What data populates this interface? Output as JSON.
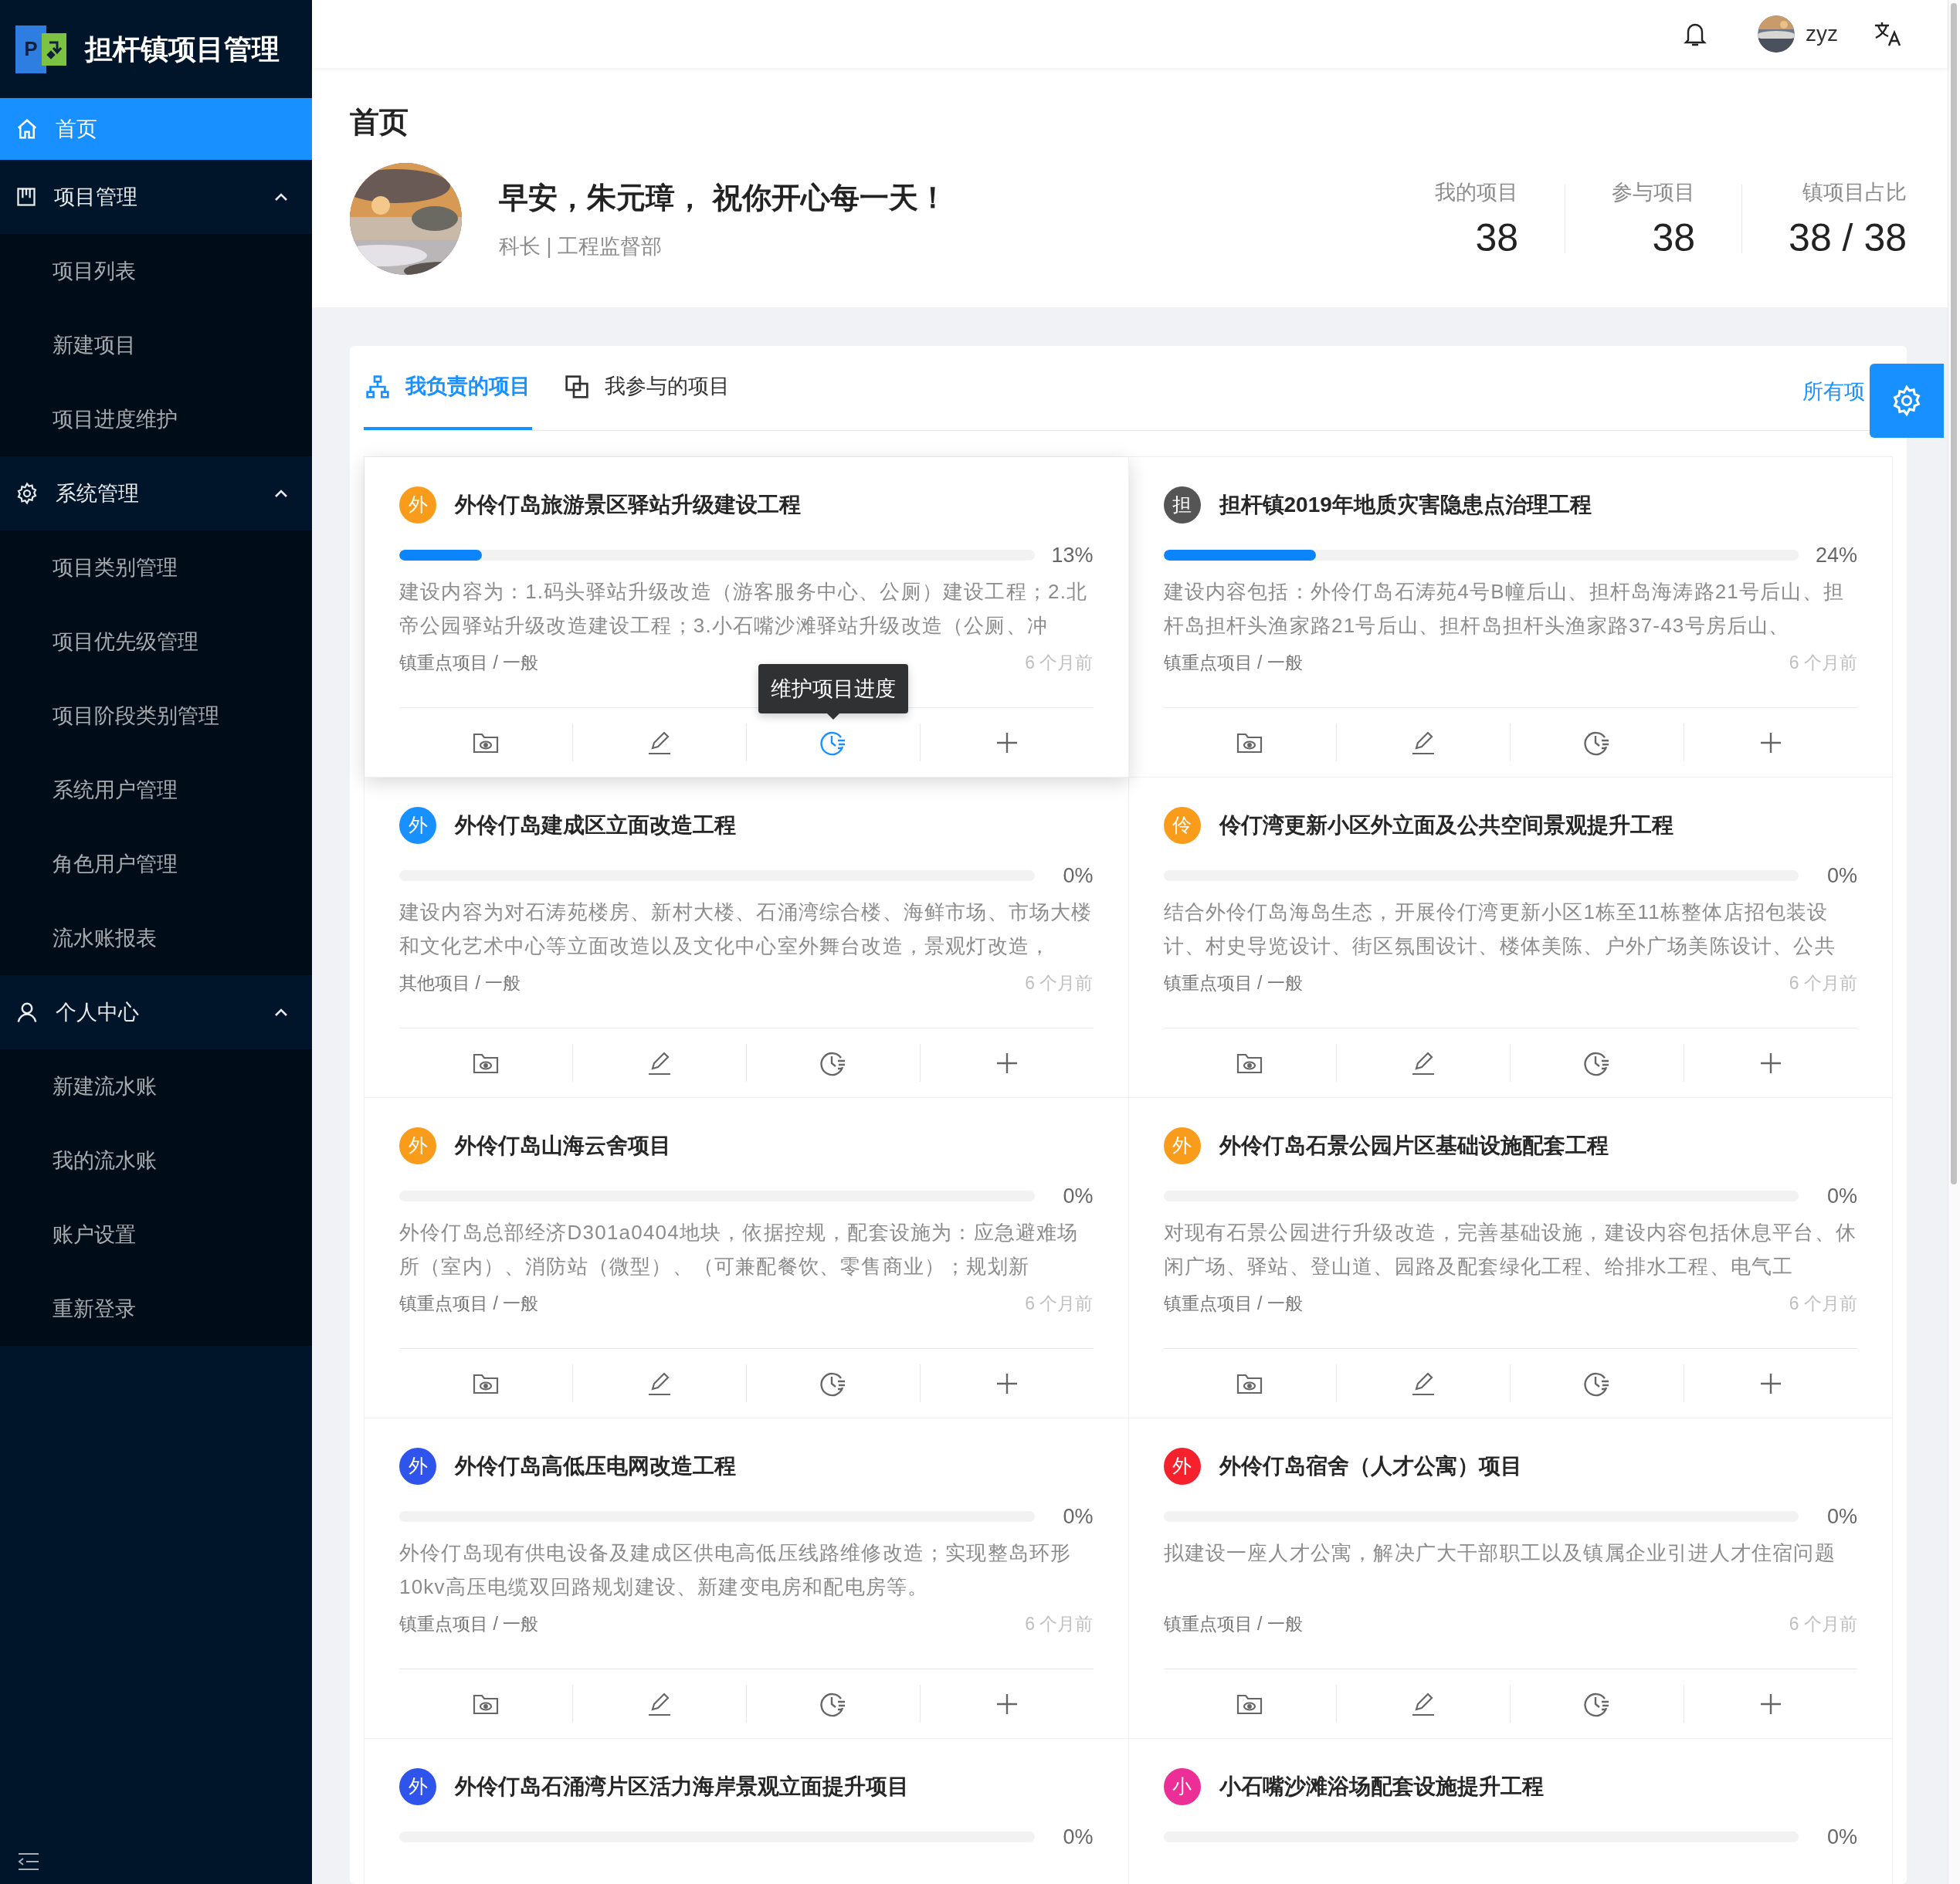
{
  "app": {
    "logo_letter": "P",
    "title": "担杆镇项目管理"
  },
  "menu": [
    {
      "label": "首页",
      "selected": true
    },
    {
      "label": "项目管理",
      "selected": false,
      "expanded": true,
      "children": [
        {
          "label": "项目列表",
          "selected": false
        },
        {
          "label": "新建项目",
          "selected": false
        },
        {
          "label": "项目进度维护",
          "selected": false
        }
      ]
    },
    {
      "label": "系统管理",
      "selected": false,
      "expanded": true,
      "children": [
        {
          "label": "项目类别管理",
          "selected": false
        },
        {
          "label": "项目优先级管理",
          "selected": false
        },
        {
          "label": "项目阶段类别管理",
          "selected": false
        },
        {
          "label": "系统用户管理",
          "selected": false
        },
        {
          "label": "角色用户管理",
          "selected": false
        },
        {
          "label": "流水账报表",
          "selected": false
        }
      ]
    },
    {
      "label": "个人中心",
      "selected": false,
      "expanded": true,
      "children": [
        {
          "label": "新建流水账",
          "selected": false
        },
        {
          "label": "我的流水账",
          "selected": false
        },
        {
          "label": "账户设置",
          "selected": false
        },
        {
          "label": "重新登录",
          "selected": false
        }
      ]
    }
  ],
  "header": {
    "username": "zyz"
  },
  "page": {
    "title": "首页",
    "greeting": "早安，朱元璋， 祝你开心每一天！",
    "subtitle": "科长 | 工程监督部",
    "stats": [
      {
        "label": "我的项目",
        "value": "38"
      },
      {
        "label": "参与项目",
        "value": "38"
      },
      {
        "label": "镇项目占比",
        "value": "38 / 38"
      }
    ]
  },
  "tabs": [
    {
      "label": "我负责的项目",
      "selected": true
    },
    {
      "label": "我参与的项目",
      "selected": false
    }
  ],
  "all_link": "所有项",
  "cards": [
    {
      "badge": "外",
      "color": "#fa9c1b",
      "title": "外伶仃岛旅游景区驿站升级建设工程",
      "level": 0.13,
      "percent": "13%",
      "description": "建设内容为：1.码头驿站升级改造（游客服务中心、公厕）建设工程；2.北帝公园驿站升级改造建设工程；3.小石嘴沙滩驿站升级改造（公厕、冲",
      "category": "镇重点项目 / 一般",
      "time": "6 个月前",
      "raised": true,
      "tooltip": "维护项目进度",
      "actions": [
        {
          "kind": "view",
          "selected": false
        },
        {
          "kind": "edit",
          "selected": false
        },
        {
          "kind": "progress",
          "selected": true
        },
        {
          "kind": "add",
          "selected": false
        }
      ]
    },
    {
      "badge": "担",
      "color": "#555555",
      "title": "担杆镇2019年地质灾害隐患点治理工程",
      "level": 0.24,
      "percent": "24%",
      "description": "建设内容包括：外伶仃岛石涛苑4号B幢后山、担杆岛海涛路21号后山、担杆岛担杆头渔家路21号后山、担杆岛担杆头渔家路37-43号房后山、",
      "category": "镇重点项目 / 一般",
      "time": "6 个月前",
      "raised": false
    },
    {
      "badge": "外",
      "color": "#1890ff",
      "title": "外伶仃岛建成区立面改造工程",
      "level": 0,
      "percent": "0%",
      "description": "建设内容为对石涛苑楼房、新村大楼、石涌湾综合楼、海鲜市场、市场大楼和文化艺术中心等立面改造以及文化中心室外舞台改造，景观灯改造，",
      "category": "其他项目 / 一般",
      "time": "6 个月前",
      "raised": false
    },
    {
      "badge": "伶",
      "color": "#fa9c1b",
      "title": "伶仃湾更新小区外立面及公共空间景观提升工程",
      "level": 0,
      "percent": "0%",
      "description": "结合外伶仃岛海岛生态，开展伶仃湾更新小区1栋至11栋整体店招包装设计、村史导览设计、街区氛围设计、楼体美陈、户外广场美陈设计、公共",
      "category": "镇重点项目 / 一般",
      "time": "6 个月前",
      "raised": false
    },
    {
      "badge": "外",
      "color": "#fa9c1b",
      "title": "外伶仃岛山海云舍项目",
      "level": 0,
      "percent": "0%",
      "description": "外伶仃岛总部经济D301a0404地块，依据控规，配套设施为：应急避难场所（室内）、消防站（微型）、（可兼配餐饮、零售商业）；规划新",
      "category": "镇重点项目 / 一般",
      "time": "6 个月前",
      "raised": false
    },
    {
      "badge": "外",
      "color": "#fa9c1b",
      "title": "外伶仃岛石景公园片区基础设施配套工程",
      "level": 0,
      "percent": "0%",
      "description": "对现有石景公园进行升级改造，完善基础设施，建设内容包括休息平台、休闲广场、驿站、登山道、园路及配套绿化工程、给排水工程、电气工",
      "category": "镇重点项目 / 一般",
      "time": "6 个月前",
      "raised": false
    },
    {
      "badge": "外",
      "color": "#2f54eb",
      "title": "外伶仃岛高低压电网改造工程",
      "level": 0,
      "percent": "0%",
      "description": "外伶仃岛现有供电设备及建成区供电高低压线路维修改造；实现整岛环形10kv高压电缆双回路规划建设、新建变电房和配电房等。",
      "category": "镇重点项目 / 一般",
      "time": "6 个月前",
      "raised": false
    },
    {
      "badge": "外",
      "color": "#f5222d",
      "title": "外伶仃岛宿舍（人才公寓）项目",
      "level": 0,
      "percent": "0%",
      "description": "拟建设一座人才公寓，解决广大干部职工以及镇属企业引进人才住宿问题",
      "category": "镇重点项目 / 一般",
      "time": "6 个月前",
      "raised": false
    },
    {
      "badge": "外",
      "color": "#2f54eb",
      "title": "外伶仃岛石涌湾片区活力海岸景观立面提升项目",
      "level": 0,
      "percent": "0%",
      "raised": false
    },
    {
      "badge": "小",
      "color": "#eb2f96",
      "title": "小石嘴沙滩浴场配套设施提升工程",
      "level": 0,
      "percent": "0%",
      "raised": false
    }
  ]
}
